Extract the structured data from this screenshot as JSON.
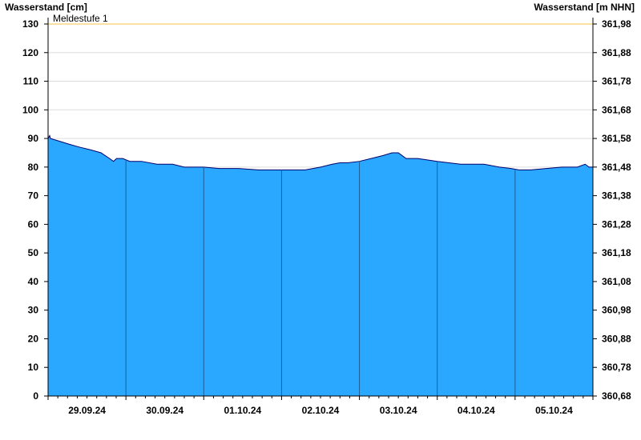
{
  "chart_data": {
    "type": "area",
    "ylabel_left": "Wasserstand [cm]",
    "ylabel_right": "Wasserstand [m NHN]",
    "ylim": [
      0,
      130
    ],
    "y_ticks_left": [
      "0",
      "10",
      "20",
      "30",
      "40",
      "50",
      "60",
      "70",
      "80",
      "90",
      "100",
      "110",
      "120",
      "130"
    ],
    "y_ticks_right": [
      "360,68",
      "360,78",
      "360,88",
      "360,98",
      "361,08",
      "361,18",
      "361,28",
      "361,38",
      "361,48",
      "361,58",
      "361,68",
      "361,78",
      "361,88",
      "361,98"
    ],
    "x_day_labels": [
      "29.09.24",
      "30.09.24",
      "01.10.24",
      "02.10.24",
      "03.10.24",
      "04.10.24",
      "05.10.24"
    ],
    "threshold": {
      "label": "Meldestufe 1",
      "value": 130,
      "color": "#f4c542"
    },
    "fill_color": "#2aa8ff",
    "line_color": "#00006e",
    "grid": true,
    "x_days_range": [
      0,
      7
    ],
    "series": [
      {
        "x": [
          0,
          0.02,
          0.03,
          0.15,
          0.27,
          0.4,
          0.55,
          0.68,
          0.79,
          0.84,
          0.88,
          0.96,
          1.05,
          1.2,
          1.4,
          1.6,
          1.75,
          1.9,
          2.0,
          2.2,
          2.45,
          2.7,
          3.0,
          3.3,
          3.5,
          3.65,
          3.75,
          3.85,
          4.0,
          4.15,
          4.3,
          4.42,
          4.5,
          4.55,
          4.6,
          4.75,
          5.0,
          5.3,
          5.6,
          5.8,
          5.95,
          6.05,
          6.2,
          6.4,
          6.6,
          6.8,
          6.9,
          6.95,
          7.0
        ],
        "y": [
          90,
          91,
          90,
          89,
          88,
          87,
          86,
          85,
          83,
          82,
          83,
          83,
          82,
          82,
          81,
          81,
          80,
          80,
          80,
          79.5,
          79.5,
          79,
          79,
          79,
          80,
          81,
          81.5,
          81.5,
          82,
          83,
          84,
          85,
          85,
          84,
          83,
          83,
          82,
          81,
          81,
          80,
          79.5,
          79,
          79,
          79.5,
          80,
          80,
          81,
          80,
          80
        ]
      }
    ]
  }
}
